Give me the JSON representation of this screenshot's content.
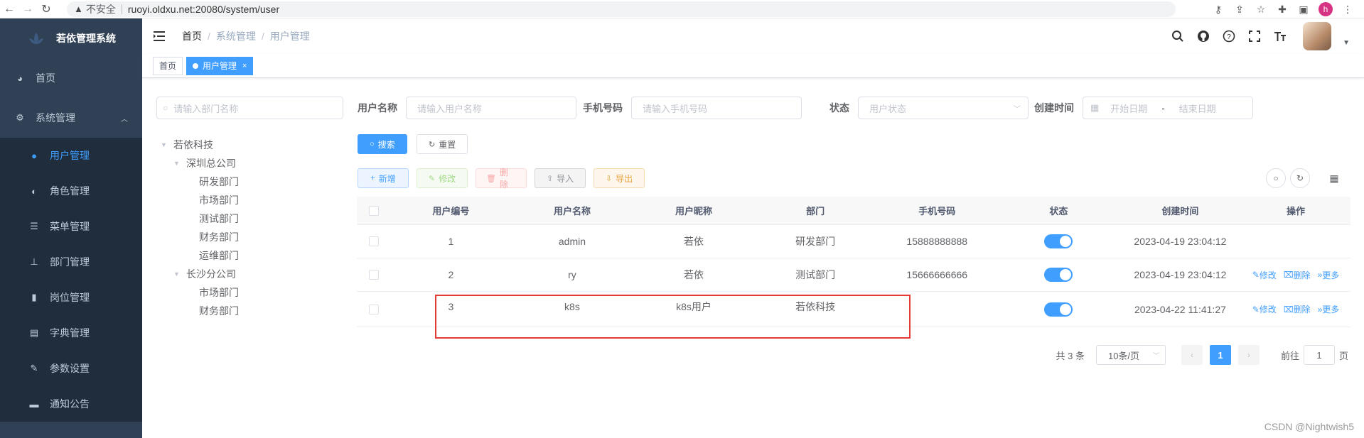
{
  "browser": {
    "insecure_label": "不安全",
    "url": "ruoyi.oldxu.net:20080/system/user",
    "profile_initial": "h"
  },
  "sidebar": {
    "brand": "若依管理系统",
    "items": [
      {
        "label": "首页",
        "icon": "dashboard-icon"
      },
      {
        "label": "系统管理",
        "icon": "gear-icon"
      }
    ],
    "sub_items": [
      {
        "label": "用户管理",
        "icon": "user-icon",
        "active": true
      },
      {
        "label": "角色管理",
        "icon": "peoples-icon"
      },
      {
        "label": "菜单管理",
        "icon": "tree-table-icon"
      },
      {
        "label": "部门管理",
        "icon": "tree-icon"
      },
      {
        "label": "岗位管理",
        "icon": "post-icon"
      },
      {
        "label": "字典管理",
        "icon": "dict-icon"
      },
      {
        "label": "参数设置",
        "icon": "edit-icon"
      },
      {
        "label": "通知公告",
        "icon": "message-icon"
      }
    ]
  },
  "navbar": {
    "breadcrumb": [
      "首页",
      "系统管理",
      "用户管理"
    ]
  },
  "tags": {
    "home": "首页",
    "active": "用户管理",
    "close": "×"
  },
  "dept_tree": {
    "search_placeholder": "请输入部门名称",
    "nodes": [
      {
        "label": "若依科技",
        "level": 0,
        "expand": true
      },
      {
        "label": "深圳总公司",
        "level": 1,
        "expand": true
      },
      {
        "label": "研发部门",
        "level": 2
      },
      {
        "label": "市场部门",
        "level": 2
      },
      {
        "label": "测试部门",
        "level": 2
      },
      {
        "label": "财务部门",
        "level": 2
      },
      {
        "label": "运维部门",
        "level": 2
      },
      {
        "label": "长沙分公司",
        "level": 1,
        "expand": true
      },
      {
        "label": "市场部门",
        "level": 2
      },
      {
        "label": "财务部门",
        "level": 2
      }
    ]
  },
  "search_form": {
    "username_label": "用户名称",
    "username_placeholder": "请输入用户名称",
    "phone_label": "手机号码",
    "phone_placeholder": "请输入手机号码",
    "status_label": "状态",
    "status_placeholder": "用户状态",
    "created_label": "创建时间",
    "start_placeholder": "开始日期",
    "range_separator": "-",
    "end_placeholder": "结束日期",
    "search_btn": "搜索",
    "reset_btn": "重置"
  },
  "toolbar": {
    "add": "新增",
    "edit": "修改",
    "delete": "删除",
    "import": "导入",
    "export": "导出"
  },
  "table": {
    "columns": [
      "用户编号",
      "用户名称",
      "用户昵称",
      "部门",
      "手机号码",
      "状态",
      "创建时间",
      "操作"
    ],
    "rows": [
      {
        "id": "1",
        "username": "admin",
        "nickname": "若依",
        "dept": "研发部门",
        "phone": "15888888888",
        "status": true,
        "created": "2023-04-19 23:04:12",
        "ops": []
      },
      {
        "id": "2",
        "username": "ry",
        "nickname": "若依",
        "dept": "测试部门",
        "phone": "15666666666",
        "status": true,
        "created": "2023-04-19 23:04:12",
        "ops": [
          "修改",
          "删除",
          "更多"
        ]
      },
      {
        "id": "3",
        "username": "k8s",
        "nickname": "k8s用户",
        "dept": "若依科技",
        "phone": "",
        "status": true,
        "created": "2023-04-22 11:41:27",
        "ops": [
          "修改",
          "删除",
          "更多"
        ]
      }
    ]
  },
  "pagination": {
    "total": "共 3 条",
    "page_size": "10条/页",
    "current": "1",
    "goto_label": "前往",
    "goto_value": "1",
    "page_unit": "页"
  },
  "watermark": "CSDN @Nightwish5",
  "colors": {
    "primary": "#409eff",
    "sidebar_bg": "#304156",
    "highlight": "#e53935"
  }
}
